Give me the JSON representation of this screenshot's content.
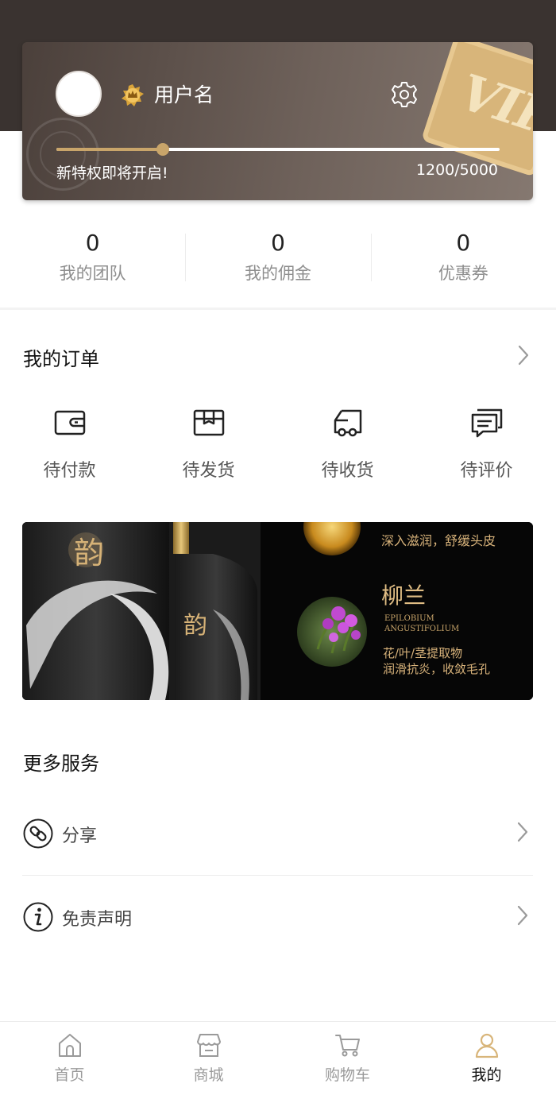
{
  "user": {
    "name": "用户名",
    "privilege_text": "新特权即将开启!",
    "progress_text": "1200/5000",
    "progress_fraction": 0.24,
    "vip_badge_text": "VIP"
  },
  "stats": [
    {
      "value": "0",
      "label": "我的团队"
    },
    {
      "value": "0",
      "label": "我的佣金"
    },
    {
      "value": "0",
      "label": "优惠券"
    }
  ],
  "orders": {
    "title": "我的订单",
    "items": [
      {
        "label": "待付款",
        "icon": "wallet-icon"
      },
      {
        "label": "待发货",
        "icon": "box-icon"
      },
      {
        "label": "待收货",
        "icon": "truck-icon"
      },
      {
        "label": "待评价",
        "icon": "comment-icon"
      }
    ]
  },
  "banner": {
    "top_caption": "深入滋润，舒缓头皮",
    "herb_name": "柳兰",
    "herb_latin_1": "EPILOBIUM",
    "herb_latin_2": "ANGUSTIFOLIUM",
    "desc_1": "花/叶/茎提取物",
    "desc_2": "润滑抗炎，收敛毛孔",
    "bottle_mark": "韵"
  },
  "services": {
    "title": "更多服务",
    "items": [
      {
        "label": "分享",
        "icon": "share-link-icon"
      },
      {
        "label": "免责声明",
        "icon": "info-icon"
      }
    ]
  },
  "tabbar": [
    {
      "label": "首页",
      "icon": "home-icon",
      "active": false
    },
    {
      "label": "商城",
      "icon": "store-icon",
      "active": false
    },
    {
      "label": "购物车",
      "icon": "cart-icon",
      "active": false
    },
    {
      "label": "我的",
      "icon": "user-icon",
      "active": true
    }
  ],
  "colors": {
    "header_bg": "#3a3330",
    "accent_gold": "#c9a56a",
    "active_icon": "#d8b57a"
  }
}
